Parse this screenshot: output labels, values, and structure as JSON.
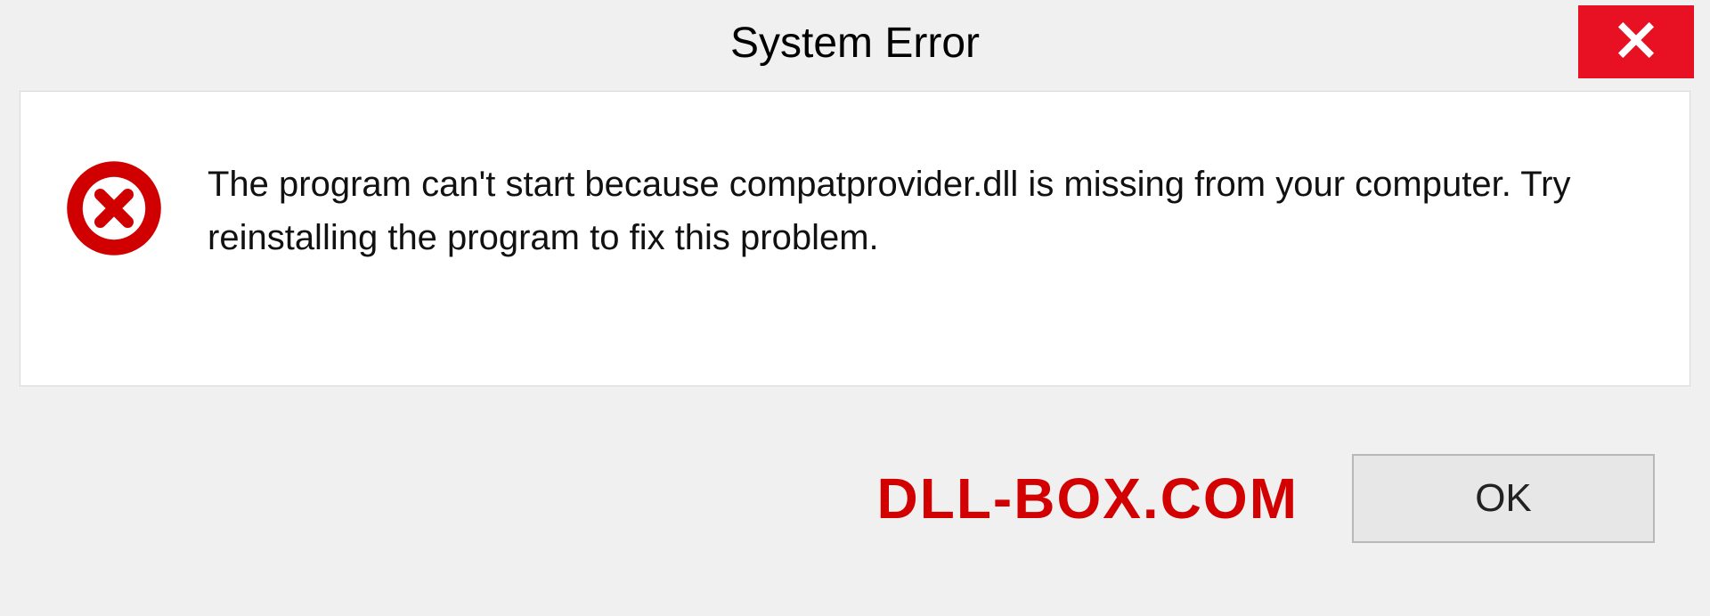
{
  "titlebar": {
    "title": "System Error"
  },
  "dialog": {
    "message": "The program can't start because compatprovider.dll is missing from your computer. Try reinstalling the program to fix this problem."
  },
  "footer": {
    "watermark": "DLL-BOX.COM",
    "ok_label": "OK"
  }
}
